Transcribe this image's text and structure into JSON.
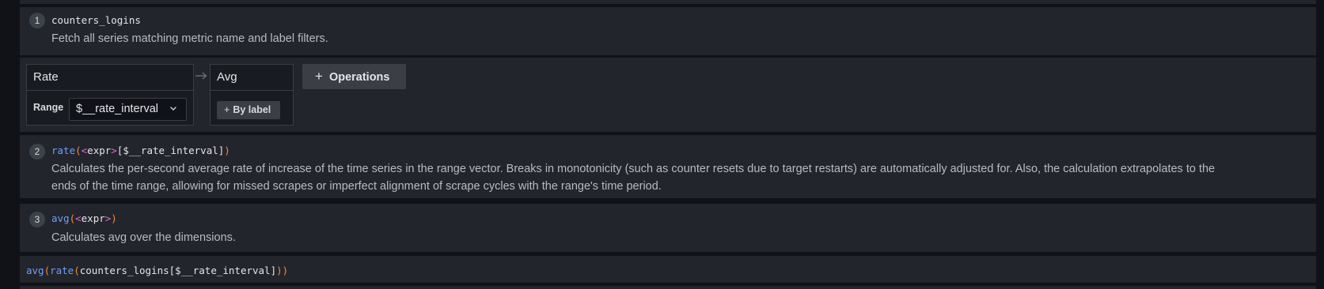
{
  "step1": {
    "number": "1",
    "metric": "counters_logins",
    "description": "Fetch all series matching metric name and label filters."
  },
  "operations": {
    "rate": {
      "title": "Rate",
      "range_label": "Range",
      "range_value": "$__rate_interval"
    },
    "avg": {
      "title": "Avg",
      "by_label_button": "By label"
    },
    "add_button": "Operations"
  },
  "step2": {
    "number": "2",
    "fn": "rate",
    "open": "(",
    "expr_open": "<",
    "expr_word": "expr",
    "expr_close": ">",
    "range": "[$__rate_interval]",
    "close": ")",
    "description_line1": "Calculates the per-second average rate of increase of the time series in the range vector. Breaks in monotonicity (such as counter resets due to target restarts) are automatically adjusted for. Also, the calculation extrapolates to the",
    "description_line2": "ends of the time range, allowing for missed scrapes or imperfect alignment of scrape cycles with the range's time period."
  },
  "step3": {
    "number": "3",
    "fn": "avg",
    "open": "(",
    "expr_open": "<",
    "expr_word": "expr",
    "expr_close": ">",
    "close": ")",
    "description": "Calculates avg over the dimensions."
  },
  "query": {
    "outer_fn": "avg",
    "outer_open": "(",
    "inner_fn": "rate",
    "inner_open": "(",
    "args": "counters_logins[$__rate_interval]",
    "inner_close": ")",
    "outer_close": ")"
  },
  "colors": {
    "function": "#6e9fff",
    "paren": "#ff8833",
    "expr_tag": "#e26bd6",
    "panel": "#22252b",
    "background": "#111217"
  },
  "icons": [
    "plus-icon",
    "chevron-down-icon",
    "arrow-right-icon"
  ]
}
